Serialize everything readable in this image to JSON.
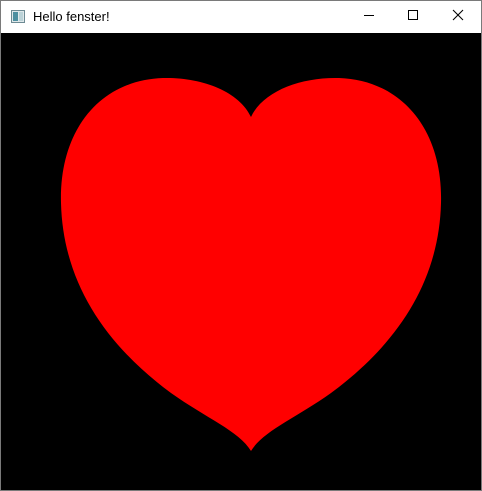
{
  "window": {
    "title": "Hello fenster!",
    "app_icon": "app-window-icon",
    "controls": {
      "minimize_icon": "minimize-icon",
      "maximize_icon": "maximize-icon",
      "close_icon": "close-icon"
    }
  },
  "canvas": {
    "background_color": "#000000",
    "shape": "heart",
    "shape_color": "#ff0000"
  }
}
